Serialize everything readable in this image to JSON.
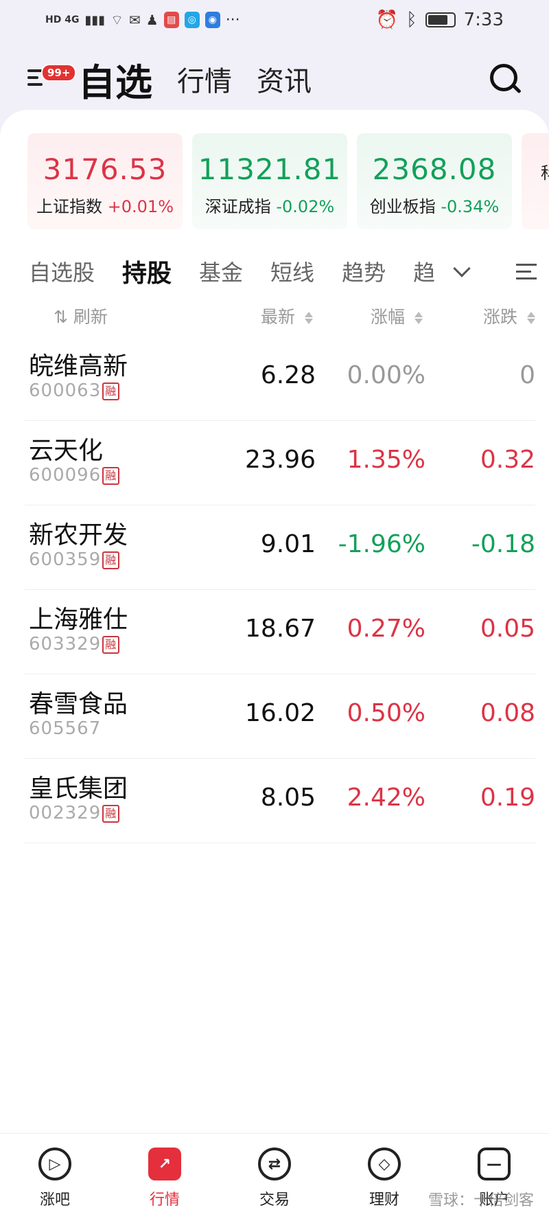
{
  "status_bar": {
    "left_text": "HD 4G",
    "more": "···",
    "time": "7:33"
  },
  "header": {
    "menu_badge": "99+",
    "tabs": [
      {
        "label": "自选",
        "active": true
      },
      {
        "label": "行情",
        "active": false
      },
      {
        "label": "资讯",
        "active": false
      }
    ],
    "search_icon": "search-icon"
  },
  "indices": [
    {
      "value": "3176.53",
      "name": "上证指数",
      "change": "+0.01%",
      "direction": "up"
    },
    {
      "value": "11321.81",
      "name": "深证成指",
      "change": "-0.02%",
      "direction": "down"
    },
    {
      "value": "2368.08",
      "name": "创业板指",
      "change": "-0.34%",
      "direction": "down"
    },
    {
      "value": "",
      "name": "科",
      "change": "",
      "direction": "up"
    }
  ],
  "sub_tabs": [
    {
      "label": "自选股",
      "active": false
    },
    {
      "label": "持股",
      "active": true
    },
    {
      "label": "基金",
      "active": false
    },
    {
      "label": "短线",
      "active": false
    },
    {
      "label": "趋势",
      "active": false
    },
    {
      "label": "趋",
      "active": false
    }
  ],
  "columns": {
    "refresh": "刷新",
    "price": "最新",
    "pct": "涨幅",
    "change": "涨跌"
  },
  "stocks": [
    {
      "name": "皖维高新",
      "code": "600063",
      "margin": true,
      "price": "6.28",
      "pct": "0.00%",
      "change": "0",
      "direction": "flat"
    },
    {
      "name": "云天化",
      "code": "600096",
      "margin": true,
      "price": "23.96",
      "pct": "1.35%",
      "change": "0.32",
      "direction": "up"
    },
    {
      "name": "新农开发",
      "code": "600359",
      "margin": true,
      "price": "9.01",
      "pct": "-1.96%",
      "change": "-0.18",
      "direction": "down"
    },
    {
      "name": "上海雅仕",
      "code": "603329",
      "margin": true,
      "price": "18.67",
      "pct": "0.27%",
      "change": "0.05",
      "direction": "up"
    },
    {
      "name": "春雪食品",
      "code": "605567",
      "margin": false,
      "price": "16.02",
      "pct": "0.50%",
      "change": "0.08",
      "direction": "up"
    },
    {
      "name": "皇氏集团",
      "code": "002329",
      "margin": true,
      "price": "8.05",
      "pct": "2.42%",
      "change": "0.19",
      "direction": "up"
    }
  ],
  "margin_tag": "融",
  "bottom_nav": [
    {
      "label": "涨吧",
      "icon": "play-bubble-icon",
      "active": false
    },
    {
      "label": "行情",
      "icon": "trend-icon",
      "active": true
    },
    {
      "label": "交易",
      "icon": "swap-icon",
      "active": false
    },
    {
      "label": "理财",
      "icon": "diamond-icon",
      "active": false
    },
    {
      "label": "账户",
      "icon": "account-icon",
      "active": false
    }
  ],
  "watermark": "雪球：十倍剑客",
  "colors": {
    "up": "#dc3446",
    "down": "#13a05a",
    "flat": "#999999",
    "accent": "#e52f3c"
  }
}
